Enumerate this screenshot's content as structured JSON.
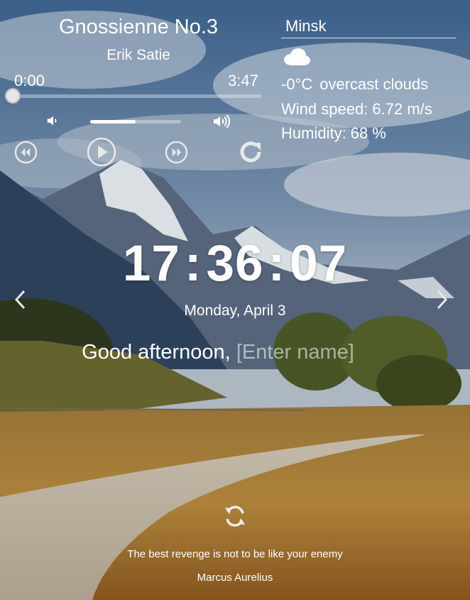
{
  "player": {
    "track_title": "Gnossienne No.3",
    "artist": "Erik Satie",
    "current_time": "0:00",
    "total_time": "3:47",
    "progress_fraction": 0.0,
    "volume_fraction": 0.5,
    "icons": [
      "volume-low-icon",
      "volume-high-icon",
      "rewind-icon",
      "play-icon",
      "fast-forward-icon",
      "repeat-icon"
    ]
  },
  "weather": {
    "city": "Minsk",
    "icon": "overcast-cloud-icon",
    "temperature": "-0°C",
    "description": "overcast clouds",
    "wind": "Wind speed: 6.72 m/s",
    "humidity": "Humidity: 68 %"
  },
  "clock": {
    "time": "17:36:07",
    "date": "Monday, April 3"
  },
  "greeting": {
    "text": "Good afternoon,",
    "name_placeholder": "[Enter name]"
  },
  "quote": {
    "text": "The best revenge is not to be like your enemy",
    "author": "Marcus Aurelius"
  },
  "colors": {
    "text": "#ffffff",
    "muted_text": "#bfc6cf",
    "sky": "#5d7796"
  }
}
